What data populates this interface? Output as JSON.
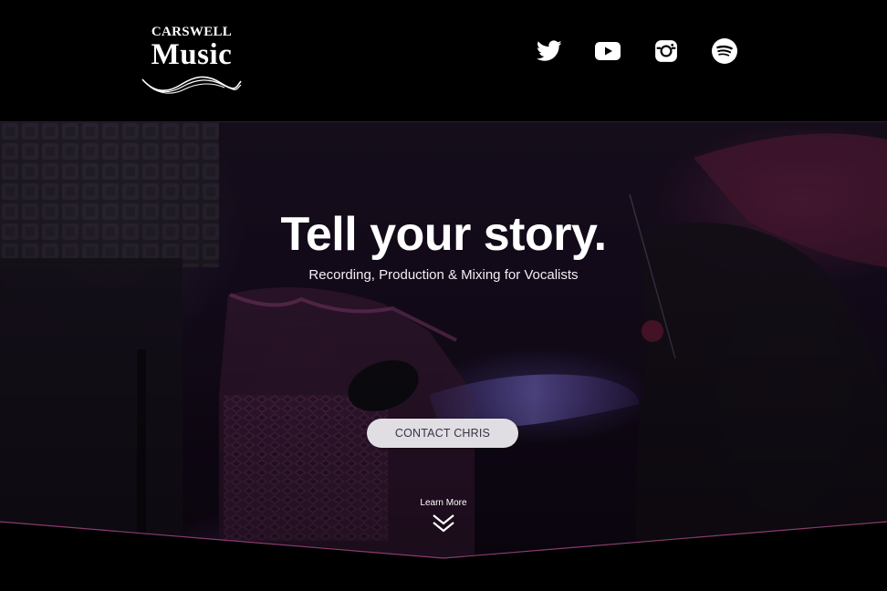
{
  "header": {
    "logo": {
      "top_text": "CARSWELL",
      "main_text": "Music"
    },
    "social": [
      {
        "name": "twitter",
        "icon": "twitter-icon"
      },
      {
        "name": "youtube",
        "icon": "youtube-icon"
      },
      {
        "name": "instagram",
        "icon": "instagram-icon"
      },
      {
        "name": "spotify",
        "icon": "spotify-icon"
      }
    ]
  },
  "hero": {
    "title": "Tell your story.",
    "subtitle": "Recording, Production & Mixing for Vocalists",
    "cta_label": "CONTACT CHRIS",
    "learn_more_label": "Learn More",
    "learn_more_icon": "double-chevron-down-icon"
  },
  "colors": {
    "background": "#000000",
    "accent_line": "#8a3b6e",
    "button_bg": "#e0dee3",
    "button_text": "#3a3344",
    "text": "#ffffff"
  }
}
